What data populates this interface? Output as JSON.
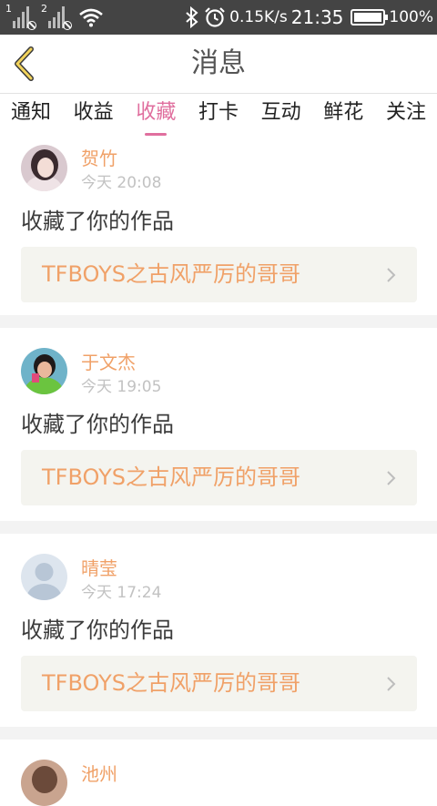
{
  "status_bar": {
    "sim1": "1",
    "sim2": "2",
    "speed": "0.15K/s",
    "time": "21:35",
    "battery": "100%"
  },
  "header": {
    "title": "消息"
  },
  "tabs": [
    {
      "label": "通知"
    },
    {
      "label": "收益"
    },
    {
      "label": "收藏"
    },
    {
      "label": "打卡"
    },
    {
      "label": "互动"
    },
    {
      "label": "鲜花"
    },
    {
      "label": "关注"
    }
  ],
  "active_tab": "收藏",
  "notifications": [
    {
      "user": "贺竹",
      "time": "今天 20:08",
      "action": "收藏了你的作品",
      "work": "TFBOYS之古风严厉的哥哥"
    },
    {
      "user": "于文杰",
      "time": "今天 19:05",
      "action": "收藏了你的作品",
      "work": "TFBOYS之古风严厉的哥哥"
    },
    {
      "user": "晴莹",
      "time": "今天 17:24",
      "action": "收藏了你的作品",
      "work": "TFBOYS之古风严厉的哥哥"
    },
    {
      "user": "池州"
    }
  ],
  "colors": {
    "accent": "#e06f9e",
    "username": "#f0a168",
    "status_bar": "#444444",
    "work_box": "#f4f4ef"
  },
  "icons": [
    "back-arrow-icon",
    "bluetooth-icon",
    "alarm-icon",
    "wifi-icon",
    "battery-icon",
    "chevron-right-icon"
  ]
}
